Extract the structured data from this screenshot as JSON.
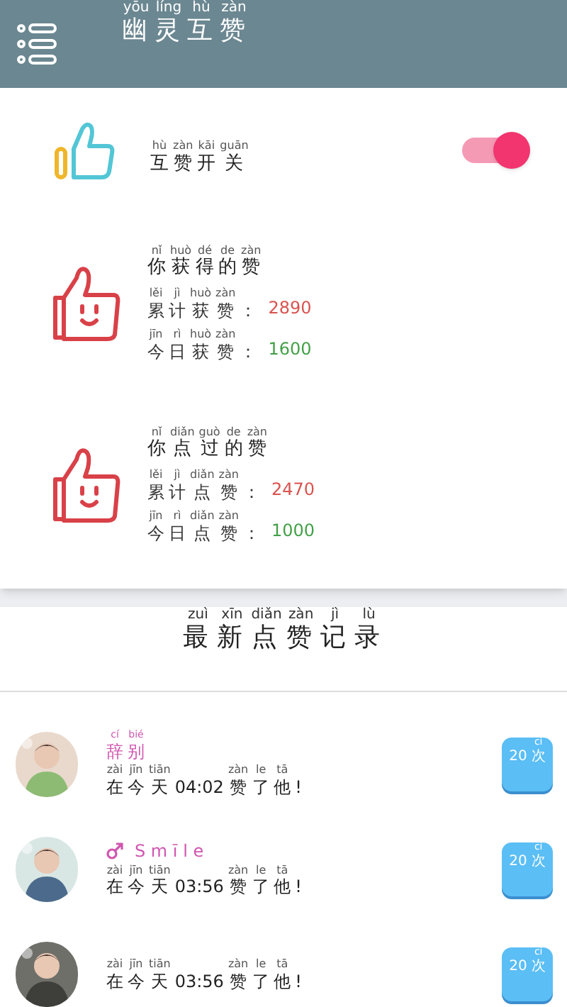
{
  "header": {
    "title": [
      {
        "t": "幽",
        "py": "yōu"
      },
      {
        "t": "灵",
        "py": "líng"
      },
      {
        "t": "互",
        "py": "hù"
      },
      {
        "t": "赞",
        "py": "zàn"
      }
    ]
  },
  "toggle": {
    "label": [
      {
        "t": "互",
        "py": "hù"
      },
      {
        "t": "赞",
        "py": "zàn"
      },
      {
        "t": "开",
        "py": "kāi"
      },
      {
        "t": "关",
        "py": "guān"
      }
    ],
    "on": true
  },
  "stats": [
    {
      "title": [
        {
          "t": "你",
          "py": "nǐ"
        },
        {
          "t": "获",
          "py": "huò"
        },
        {
          "t": "得",
          "py": "dé"
        },
        {
          "t": "的",
          "py": "de"
        },
        {
          "t": "赞",
          "py": "zàn"
        }
      ],
      "rows": [
        {
          "label": [
            {
              "t": "累",
              "py": "lěi"
            },
            {
              "t": "计",
              "py": "jì"
            },
            {
              "t": "获",
              "py": "huò"
            },
            {
              "t": "赞",
              "py": "zàn"
            },
            {
              "t": "："
            }
          ],
          "value": "2890",
          "color": "#d9534f"
        },
        {
          "label": [
            {
              "t": "今",
              "py": "jīn"
            },
            {
              "t": "日",
              "py": "rì"
            },
            {
              "t": "获",
              "py": "huò"
            },
            {
              "t": "赞",
              "py": "zàn"
            },
            {
              "t": "："
            }
          ],
          "value": "1600",
          "color": "#43a047"
        }
      ]
    },
    {
      "title": [
        {
          "t": "你",
          "py": "nǐ"
        },
        {
          "t": "点",
          "py": "diǎn"
        },
        {
          "t": "过",
          "py": "guò"
        },
        {
          "t": "的",
          "py": "de"
        },
        {
          "t": "赞",
          "py": "zàn"
        }
      ],
      "rows": [
        {
          "label": [
            {
              "t": "累",
              "py": "lěi"
            },
            {
              "t": "计",
              "py": "jì"
            },
            {
              "t": "点",
              "py": "diǎn"
            },
            {
              "t": "赞",
              "py": "zàn"
            },
            {
              "t": "："
            }
          ],
          "value": "2470",
          "color": "#d9534f"
        },
        {
          "label": [
            {
              "t": "今",
              "py": "jīn"
            },
            {
              "t": "日",
              "py": "rì"
            },
            {
              "t": "点",
              "py": "diǎn"
            },
            {
              "t": "赞",
              "py": "zàn"
            },
            {
              "t": "："
            }
          ],
          "value": "1000",
          "color": "#43a047"
        }
      ]
    }
  ],
  "records_title": [
    {
      "t": "最",
      "py": "zuì"
    },
    {
      "t": "新",
      "py": "xīn"
    },
    {
      "t": "点",
      "py": "diǎn"
    },
    {
      "t": "赞",
      "py": "zàn"
    },
    {
      "t": "记",
      "py": "jì"
    },
    {
      "t": "录",
      "py": "lù"
    }
  ],
  "records": [
    {
      "avatar": {
        "kind": "picture"
      },
      "name": [
        {
          "t": "辞",
          "py": "cí"
        },
        {
          "t": "别",
          "py": "bié"
        }
      ],
      "name_icon": false,
      "text": [
        {
          "t": "在",
          "py": "zài"
        },
        {
          "t": "今",
          "py": "jīn"
        },
        {
          "t": "天",
          "py": "tiān"
        },
        {
          "t": "04:02"
        },
        {
          "t": "赞",
          "py": "zàn"
        },
        {
          "t": "了",
          "py": "le"
        },
        {
          "t": "他",
          "py": "tā"
        },
        {
          "t": "!"
        }
      ],
      "count": [
        {
          "t": "20"
        },
        {
          "t": "次",
          "py": "cì"
        }
      ]
    },
    {
      "avatar": {
        "kind": "picture"
      },
      "name": [
        {
          "t": "S m ī l e"
        }
      ],
      "name_icon": true,
      "text": [
        {
          "t": "在",
          "py": "zài"
        },
        {
          "t": "今",
          "py": "jīn"
        },
        {
          "t": "天",
          "py": "tiān"
        },
        {
          "t": "03:56"
        },
        {
          "t": "赞",
          "py": "zàn"
        },
        {
          "t": "了",
          "py": "le"
        },
        {
          "t": "他",
          "py": "tā"
        },
        {
          "t": "!"
        }
      ],
      "count": [
        {
          "t": "20"
        },
        {
          "t": "次",
          "py": "cì"
        }
      ]
    },
    {
      "avatar": {
        "kind": "picture"
      },
      "name_icon": false,
      "text": [
        {
          "t": "在",
          "py": "zài"
        },
        {
          "t": "今",
          "py": "jīn"
        },
        {
          "t": "天",
          "py": "tiān"
        },
        {
          "t": "03:56"
        },
        {
          "t": "赞",
          "py": "zàn"
        },
        {
          "t": "了",
          "py": "le"
        },
        {
          "t": "他",
          "py": "tā"
        },
        {
          "t": "!"
        }
      ],
      "count": [
        {
          "t": "20"
        },
        {
          "t": "次",
          "py": "cì"
        }
      ]
    }
  ]
}
